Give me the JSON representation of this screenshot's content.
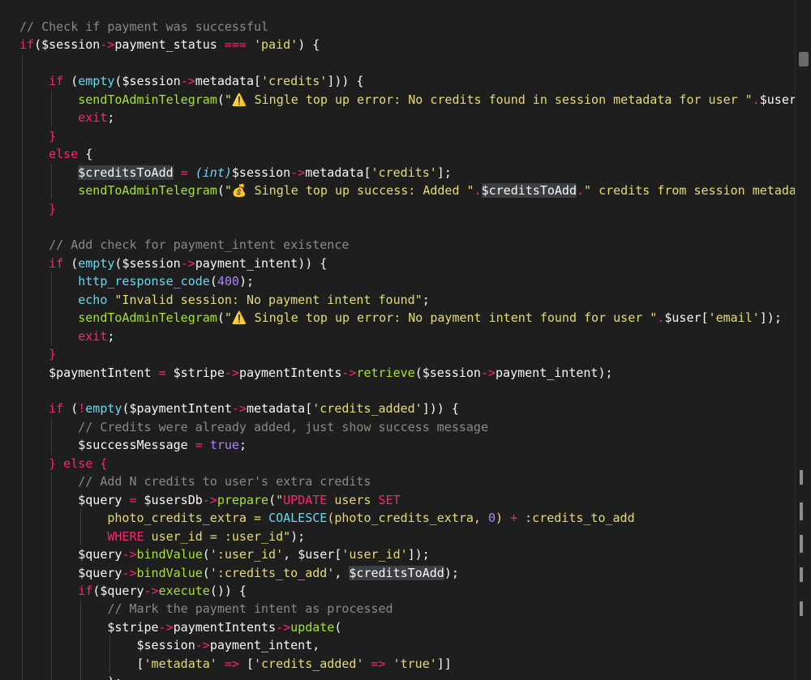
{
  "editor": {
    "lines": [
      [
        {
          "t": "// Check if payment was successful",
          "c": "comment"
        }
      ],
      [
        {
          "t": "if",
          "c": "keyword"
        },
        {
          "t": "(",
          "c": "punc"
        },
        {
          "t": "$session",
          "c": "var"
        },
        {
          "t": "->",
          "c": "op"
        },
        {
          "t": "payment_status",
          "c": "prop"
        },
        {
          "t": " ",
          "c": "plain"
        },
        {
          "t": "===",
          "c": "op"
        },
        {
          "t": " ",
          "c": "plain"
        },
        {
          "t": "'paid'",
          "c": "str"
        },
        {
          "t": ") {",
          "c": "punc"
        }
      ],
      [],
      [
        {
          "t": "    ",
          "c": "plain"
        },
        {
          "t": "if",
          "c": "keyword"
        },
        {
          "t": " (",
          "c": "punc"
        },
        {
          "t": "empty",
          "c": "builtin"
        },
        {
          "t": "(",
          "c": "punc"
        },
        {
          "t": "$session",
          "c": "var"
        },
        {
          "t": "->",
          "c": "op"
        },
        {
          "t": "metadata",
          "c": "prop"
        },
        {
          "t": "[",
          "c": "punc"
        },
        {
          "t": "'credits'",
          "c": "str"
        },
        {
          "t": "])) {",
          "c": "punc"
        }
      ],
      [
        {
          "t": "        ",
          "c": "plain"
        },
        {
          "t": "sendToAdminTelegram",
          "c": "fn"
        },
        {
          "t": "(",
          "c": "punc"
        },
        {
          "t": "\"",
          "c": "str"
        },
        {
          "t": "⚠️",
          "c": "emoji"
        },
        {
          "t": " Single top up error: No credits found in session metadata for user \"",
          "c": "str"
        },
        {
          "t": ".",
          "c": "op"
        },
        {
          "t": "$user",
          "c": "var"
        },
        {
          "t": "['e",
          "c": "str"
        }
      ],
      [
        {
          "t": "        ",
          "c": "plain"
        },
        {
          "t": "exit",
          "c": "keyword"
        },
        {
          "t": ";",
          "c": "punc"
        }
      ],
      [
        {
          "t": "    ",
          "c": "plain"
        },
        {
          "t": "}",
          "c": "keyword"
        }
      ],
      [
        {
          "t": "    ",
          "c": "plain"
        },
        {
          "t": "else",
          "c": "keyword"
        },
        {
          "t": " {",
          "c": "punc"
        }
      ],
      [
        {
          "t": "        ",
          "c": "plain"
        },
        {
          "t": "$creditsToAdd",
          "c": "var",
          "hl": true
        },
        {
          "t": " ",
          "c": "plain"
        },
        {
          "t": "=",
          "c": "op"
        },
        {
          "t": " ",
          "c": "plain"
        },
        {
          "t": "(int)",
          "c": "cast"
        },
        {
          "t": "$session",
          "c": "var"
        },
        {
          "t": "->",
          "c": "op"
        },
        {
          "t": "metadata",
          "c": "prop"
        },
        {
          "t": "[",
          "c": "punc"
        },
        {
          "t": "'credits'",
          "c": "str"
        },
        {
          "t": "];",
          "c": "punc"
        }
      ],
      [
        {
          "t": "        ",
          "c": "plain"
        },
        {
          "t": "sendToAdminTelegram",
          "c": "fn"
        },
        {
          "t": "(",
          "c": "punc"
        },
        {
          "t": "\"",
          "c": "str"
        },
        {
          "t": "💰",
          "c": "emoji"
        },
        {
          "t": " Single top up success: Added \"",
          "c": "str"
        },
        {
          "t": ".",
          "c": "op"
        },
        {
          "t": "$creditsToAdd",
          "c": "var",
          "hl": true
        },
        {
          "t": ".",
          "c": "op"
        },
        {
          "t": "\" credits from session metadata",
          "c": "str"
        }
      ],
      [
        {
          "t": "    ",
          "c": "plain"
        },
        {
          "t": "}",
          "c": "keyword"
        }
      ],
      [],
      [
        {
          "t": "    ",
          "c": "plain"
        },
        {
          "t": "// Add check for payment_intent existence",
          "c": "comment"
        }
      ],
      [
        {
          "t": "    ",
          "c": "plain"
        },
        {
          "t": "if",
          "c": "keyword"
        },
        {
          "t": " (",
          "c": "punc"
        },
        {
          "t": "empty",
          "c": "builtin"
        },
        {
          "t": "(",
          "c": "punc"
        },
        {
          "t": "$session",
          "c": "var"
        },
        {
          "t": "->",
          "c": "op"
        },
        {
          "t": "payment_intent",
          "c": "prop"
        },
        {
          "t": ")) {",
          "c": "punc"
        }
      ],
      [
        {
          "t": "        ",
          "c": "plain"
        },
        {
          "t": "http_response_code",
          "c": "builtin"
        },
        {
          "t": "(",
          "c": "punc"
        },
        {
          "t": "400",
          "c": "num"
        },
        {
          "t": ");",
          "c": "punc"
        }
      ],
      [
        {
          "t": "        ",
          "c": "plain"
        },
        {
          "t": "echo",
          "c": "builtin"
        },
        {
          "t": " ",
          "c": "plain"
        },
        {
          "t": "\"Invalid session: No payment intent found\"",
          "c": "str"
        },
        {
          "t": ";",
          "c": "punc"
        }
      ],
      [
        {
          "t": "        ",
          "c": "plain"
        },
        {
          "t": "sendToAdminTelegram",
          "c": "fn"
        },
        {
          "t": "(",
          "c": "punc"
        },
        {
          "t": "\"",
          "c": "str"
        },
        {
          "t": "⚠️",
          "c": "emoji"
        },
        {
          "t": " Single top up error: No payment intent found for user \"",
          "c": "str"
        },
        {
          "t": ".",
          "c": "op"
        },
        {
          "t": "$user",
          "c": "var"
        },
        {
          "t": "[",
          "c": "punc"
        },
        {
          "t": "'email'",
          "c": "str"
        },
        {
          "t": "]);",
          "c": "punc"
        }
      ],
      [
        {
          "t": "        ",
          "c": "plain"
        },
        {
          "t": "exit",
          "c": "keyword"
        },
        {
          "t": ";",
          "c": "punc"
        }
      ],
      [
        {
          "t": "    ",
          "c": "plain"
        },
        {
          "t": "}",
          "c": "keyword"
        }
      ],
      [
        {
          "t": "    ",
          "c": "plain"
        },
        {
          "t": "$paymentIntent",
          "c": "var"
        },
        {
          "t": " ",
          "c": "plain"
        },
        {
          "t": "=",
          "c": "op"
        },
        {
          "t": " ",
          "c": "plain"
        },
        {
          "t": "$stripe",
          "c": "var"
        },
        {
          "t": "->",
          "c": "op"
        },
        {
          "t": "paymentIntents",
          "c": "prop"
        },
        {
          "t": "->",
          "c": "op"
        },
        {
          "t": "retrieve",
          "c": "fn"
        },
        {
          "t": "(",
          "c": "punc"
        },
        {
          "t": "$session",
          "c": "var"
        },
        {
          "t": "->",
          "c": "op"
        },
        {
          "t": "payment_intent",
          "c": "prop"
        },
        {
          "t": ");",
          "c": "punc"
        }
      ],
      [],
      [
        {
          "t": "    ",
          "c": "plain"
        },
        {
          "t": "if",
          "c": "keyword"
        },
        {
          "t": " (",
          "c": "punc"
        },
        {
          "t": "!",
          "c": "op"
        },
        {
          "t": "empty",
          "c": "builtin"
        },
        {
          "t": "(",
          "c": "punc"
        },
        {
          "t": "$paymentIntent",
          "c": "var"
        },
        {
          "t": "->",
          "c": "op"
        },
        {
          "t": "metadata",
          "c": "prop"
        },
        {
          "t": "[",
          "c": "punc"
        },
        {
          "t": "'credits_added'",
          "c": "str"
        },
        {
          "t": "])) {",
          "c": "punc"
        }
      ],
      [
        {
          "t": "        ",
          "c": "plain"
        },
        {
          "t": "// Credits were already added, just show success message",
          "c": "comment"
        }
      ],
      [
        {
          "t": "        ",
          "c": "plain"
        },
        {
          "t": "$successMessage",
          "c": "var"
        },
        {
          "t": " ",
          "c": "plain"
        },
        {
          "t": "=",
          "c": "op"
        },
        {
          "t": " ",
          "c": "plain"
        },
        {
          "t": "true",
          "c": "bool"
        },
        {
          "t": ";",
          "c": "punc"
        }
      ],
      [
        {
          "t": "    ",
          "c": "plain"
        },
        {
          "t": "} else {",
          "c": "keyword"
        }
      ],
      [
        {
          "t": "        ",
          "c": "plain"
        },
        {
          "t": "// Add N credits to user's extra credits",
          "c": "comment"
        }
      ],
      [
        {
          "t": "        ",
          "c": "plain"
        },
        {
          "t": "$query",
          "c": "var"
        },
        {
          "t": " ",
          "c": "plain"
        },
        {
          "t": "=",
          "c": "op"
        },
        {
          "t": " ",
          "c": "plain"
        },
        {
          "t": "$usersDb",
          "c": "var"
        },
        {
          "t": "->",
          "c": "op"
        },
        {
          "t": "prepare",
          "c": "fn"
        },
        {
          "t": "(",
          "c": "punc"
        },
        {
          "t": "\"",
          "c": "str"
        },
        {
          "t": "UPDATE",
          "c": "keyword"
        },
        {
          "t": " users ",
          "c": "str"
        },
        {
          "t": "SET",
          "c": "keyword"
        }
      ],
      [
        {
          "t": "            ",
          "c": "plain"
        },
        {
          "t": "photo_credits_extra = ",
          "c": "str"
        },
        {
          "t": "COALESCE",
          "c": "builtin"
        },
        {
          "t": "(photo_credits_extra, ",
          "c": "str"
        },
        {
          "t": "0",
          "c": "num"
        },
        {
          "t": ") ",
          "c": "str"
        },
        {
          "t": "+",
          "c": "op"
        },
        {
          "t": " :credits_to_add",
          "c": "str"
        }
      ],
      [
        {
          "t": "            ",
          "c": "plain"
        },
        {
          "t": "WHERE",
          "c": "keyword"
        },
        {
          "t": " user_id = :user_id\"",
          "c": "str"
        },
        {
          "t": ");",
          "c": "punc"
        }
      ],
      [
        {
          "t": "        ",
          "c": "plain"
        },
        {
          "t": "$query",
          "c": "var"
        },
        {
          "t": "->",
          "c": "op"
        },
        {
          "t": "bindValue",
          "c": "fn"
        },
        {
          "t": "(",
          "c": "punc"
        },
        {
          "t": "':user_id'",
          "c": "str"
        },
        {
          "t": ", ",
          "c": "punc"
        },
        {
          "t": "$user",
          "c": "var"
        },
        {
          "t": "[",
          "c": "punc"
        },
        {
          "t": "'user_id'",
          "c": "str"
        },
        {
          "t": "]);",
          "c": "punc"
        }
      ],
      [
        {
          "t": "        ",
          "c": "plain"
        },
        {
          "t": "$query",
          "c": "var"
        },
        {
          "t": "->",
          "c": "op"
        },
        {
          "t": "bindValue",
          "c": "fn"
        },
        {
          "t": "(",
          "c": "punc"
        },
        {
          "t": "':credits_to_add'",
          "c": "str"
        },
        {
          "t": ", ",
          "c": "punc"
        },
        {
          "t": "$creditsToAdd",
          "c": "var",
          "hl": true
        },
        {
          "t": ");",
          "c": "punc"
        }
      ],
      [
        {
          "t": "        ",
          "c": "plain"
        },
        {
          "t": "if",
          "c": "keyword"
        },
        {
          "t": "(",
          "c": "punc"
        },
        {
          "t": "$query",
          "c": "var"
        },
        {
          "t": "->",
          "c": "op"
        },
        {
          "t": "execute",
          "c": "fn"
        },
        {
          "t": "()) {",
          "c": "punc"
        }
      ],
      [
        {
          "t": "            ",
          "c": "plain"
        },
        {
          "t": "// Mark the payment intent as processed",
          "c": "comment"
        }
      ],
      [
        {
          "t": "            ",
          "c": "plain"
        },
        {
          "t": "$stripe",
          "c": "var"
        },
        {
          "t": "->",
          "c": "op"
        },
        {
          "t": "paymentIntents",
          "c": "prop"
        },
        {
          "t": "->",
          "c": "op"
        },
        {
          "t": "update",
          "c": "fn"
        },
        {
          "t": "(",
          "c": "punc"
        }
      ],
      [
        {
          "t": "                ",
          "c": "plain"
        },
        {
          "t": "$session",
          "c": "var"
        },
        {
          "t": "->",
          "c": "op"
        },
        {
          "t": "payment_intent",
          "c": "prop"
        },
        {
          "t": ",",
          "c": "punc"
        }
      ],
      [
        {
          "t": "                ",
          "c": "plain"
        },
        {
          "t": "[",
          "c": "punc"
        },
        {
          "t": "'metadata'",
          "c": "str"
        },
        {
          "t": " ",
          "c": "plain"
        },
        {
          "t": "=>",
          "c": "op"
        },
        {
          "t": " [",
          "c": "punc"
        },
        {
          "t": "'credits_added'",
          "c": "str"
        },
        {
          "t": " ",
          "c": "plain"
        },
        {
          "t": "=>",
          "c": "op"
        },
        {
          "t": " ",
          "c": "plain"
        },
        {
          "t": "'true'",
          "c": "str"
        },
        {
          "t": "]]",
          "c": "punc"
        }
      ],
      [
        {
          "t": "            ",
          "c": "plain"
        },
        {
          "t": ");",
          "c": "punc"
        }
      ]
    ]
  }
}
